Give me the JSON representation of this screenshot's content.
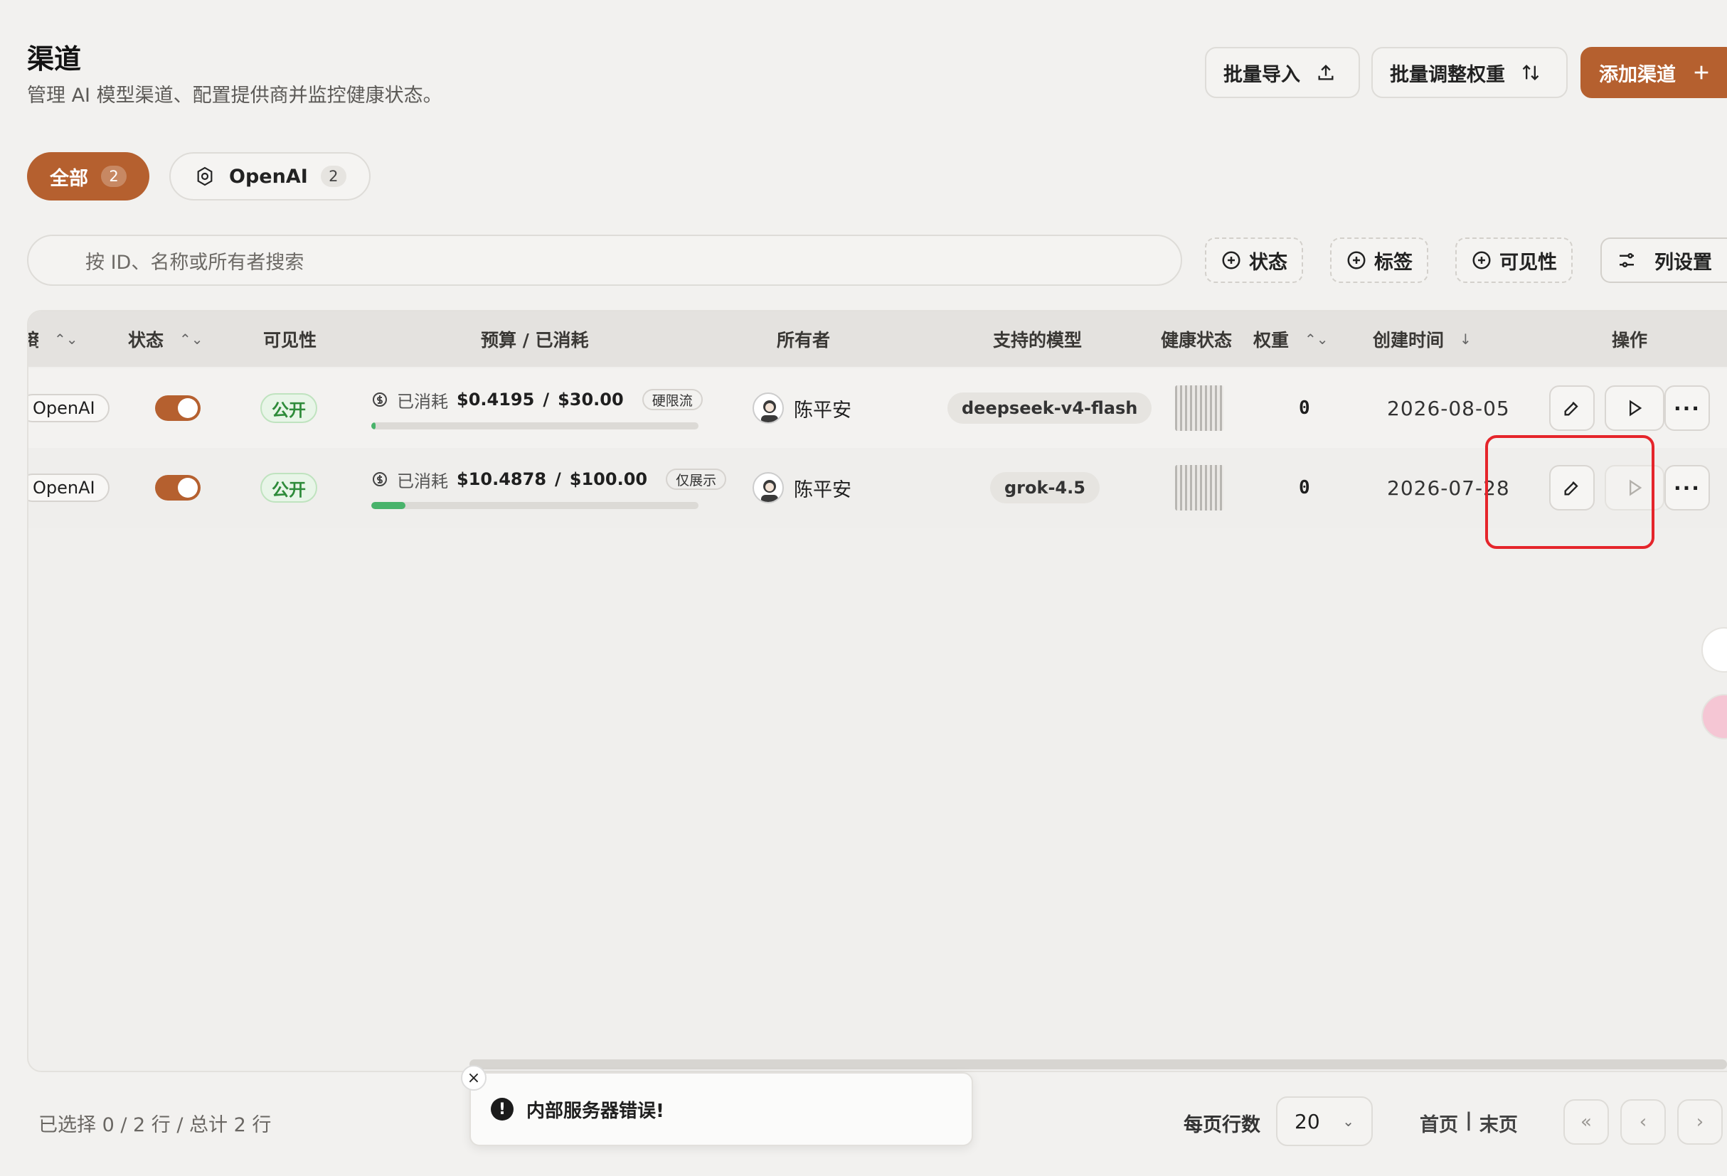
{
  "header": {
    "title": "渠道",
    "subtitle": "管理 AI 模型渠道、配置提供商并监控健康状态。",
    "buttons": {
      "import": "批量导入",
      "weights": "批量调整权重",
      "add": "添加渠道"
    }
  },
  "filters": {
    "chips": [
      {
        "label": "全部",
        "count": "2"
      },
      {
        "label": "OpenAI",
        "count": "2"
      }
    ],
    "search_placeholder": "按 ID、名称或所有者搜索",
    "status": "状态",
    "tags": "标签",
    "visibility": "可见性",
    "columns": "列设置"
  },
  "table": {
    "headers": {
      "provider": "商",
      "status": "状态",
      "visibility": "可见性",
      "budget": "预算 / 已消耗",
      "owner": "所有者",
      "models": "支持的模型",
      "health": "健康状态",
      "weight": "权重",
      "created": "创建时间",
      "actions": "操作"
    },
    "rows": [
      {
        "provider": "OpenAI",
        "visibility": "公开",
        "spent_label": "已消耗",
        "spent": "$0.4195",
        "sep": "/",
        "budget": "$30.00",
        "budget_tag": "硬限流",
        "progress": 0.014,
        "owner": "陈平安",
        "model": "deepseek-v4-flash",
        "weight": "0",
        "created": "2026-08-05"
      },
      {
        "provider": "OpenAI",
        "visibility": "公开",
        "spent_label": "已消耗",
        "spent": "$10.4878",
        "sep": "/",
        "budget": "$100.00",
        "budget_tag": "仅展示",
        "progress": 0.105,
        "owner": "陈平安",
        "model": "grok-4.5",
        "weight": "0",
        "created": "2026-07-28"
      }
    ]
  },
  "footer": {
    "selection": "已选择 0 / 2 行 / 总计 2 行",
    "rows_per_page_label": "每页行数",
    "rows_per_page": "20",
    "first": "首页",
    "divider": "|",
    "last": "末页"
  },
  "toast": {
    "message": "内部服务器错误!"
  },
  "colors": {
    "accent": "#b5602f",
    "success": "#49b36b",
    "highlight": "#e5252b"
  }
}
